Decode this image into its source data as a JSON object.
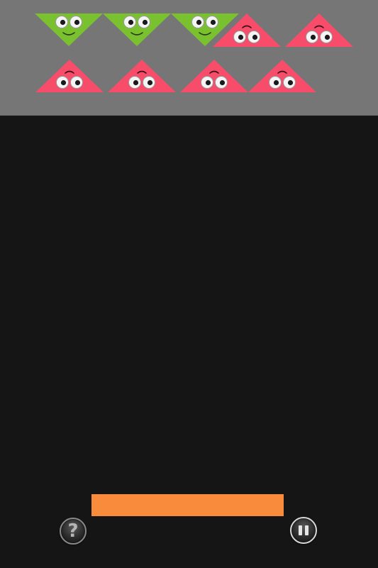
{
  "colors": {
    "top_panel": "#767676",
    "background": "#151515",
    "green_block": "#7ac12f",
    "pink_block": "#f74d6a",
    "paddle": "#f98c3c"
  },
  "blocks": [
    {
      "color": "green",
      "orientation": "down",
      "mood": "smile"
    },
    {
      "color": "green",
      "orientation": "down",
      "mood": "smile"
    },
    {
      "color": "green",
      "orientation": "down",
      "mood": "smile"
    },
    {
      "color": "pink",
      "orientation": "up",
      "mood": "neutral"
    },
    {
      "color": "pink",
      "orientation": "up",
      "mood": "neutral"
    },
    {
      "color": "pink",
      "orientation": "up",
      "mood": "neutral"
    },
    {
      "color": "pink",
      "orientation": "up",
      "mood": "neutral"
    },
    {
      "color": "pink",
      "orientation": "up",
      "mood": "neutral"
    },
    {
      "color": "pink",
      "orientation": "up",
      "mood": "neutral"
    }
  ],
  "controls": {
    "help": {
      "icon": "question-mark-icon",
      "glyph": "?"
    },
    "pause": {
      "icon": "pause-icon"
    }
  }
}
